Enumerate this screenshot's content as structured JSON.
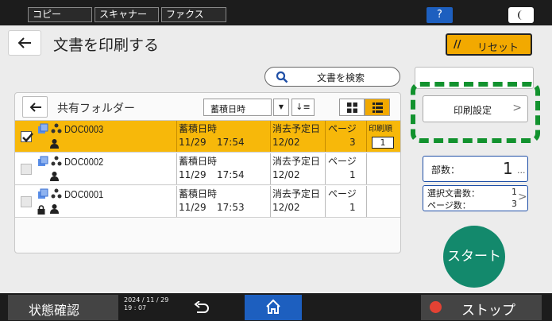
{
  "top_tabs": [
    "コピー",
    "スキャナー",
    "ファクス"
  ],
  "help_label": "?",
  "page_title": "文書を印刷する",
  "reset_label": "リセット",
  "search_label": "文書を検索",
  "folder": {
    "title": "共有フォルダー",
    "sort_label": "蓄積日時",
    "sort_order_label": "↓≡"
  },
  "documents": [
    {
      "name": "DOC0003",
      "stored_label": "蓄積日時",
      "stored_date": "11/29",
      "stored_time": "17:54",
      "delete_label": "消去予定日",
      "delete_date": "12/02",
      "pages_label": "ページ",
      "pages": "3",
      "order_label": "印刷順",
      "order": "1",
      "selected": true,
      "locked": false
    },
    {
      "name": "DOC0002",
      "stored_label": "蓄積日時",
      "stored_date": "11/29",
      "stored_time": "17:54",
      "delete_label": "消去予定日",
      "delete_date": "12/02",
      "pages_label": "ページ",
      "pages": "1",
      "selected": false,
      "locked": false
    },
    {
      "name": "DOC0001",
      "stored_label": "蓄積日時",
      "stored_date": "11/29",
      "stored_time": "17:53",
      "delete_label": "消去予定日",
      "delete_date": "12/02",
      "pages_label": "ページ",
      "pages": "1",
      "selected": false,
      "locked": true
    }
  ],
  "side": {
    "print_settings_label": "印刷設定",
    "copies_label": "部数：",
    "copies_value": "1",
    "selected_docs_label": "選択文書数：",
    "selected_docs_value": "1",
    "pages_label": "ページ数：",
    "pages_value": "3",
    "start_label": "スタート"
  },
  "bottom": {
    "status_label": "状態確認",
    "date": "2024 / 11 / 29",
    "time": "19 : 07",
    "stop_label": "ストップ"
  },
  "colors": {
    "accent": "#f2a900",
    "highlight": "#12922e",
    "start": "#13896c",
    "home": "#1d5fbf"
  }
}
